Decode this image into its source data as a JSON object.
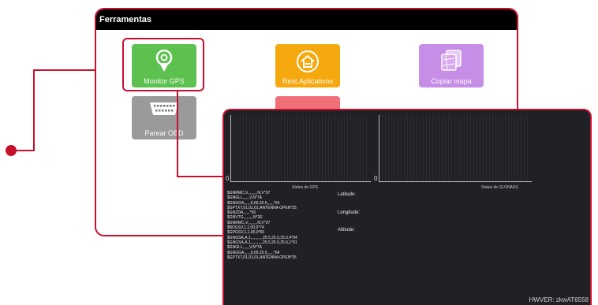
{
  "back": {
    "title": "Ferramentas",
    "tiles": [
      {
        "label": "Monitor GPS",
        "icon": "location-pin-icon",
        "color": "#5cc14f"
      },
      {
        "label": "Rest.Aplicativos",
        "icon": "home-restore-icon",
        "color": "#f6a80f"
      },
      {
        "label": "Copiar mapa",
        "icon": "map-copy-icon",
        "color": "#c68ee6"
      },
      {
        "label": "Parear OBD",
        "icon": "obd-connector-icon",
        "color": "#9a9a9a"
      },
      {
        "label": "",
        "icon": "partial-app-icon",
        "color": "#f0707a"
      }
    ]
  },
  "front": {
    "gps_status": "Status de GPS",
    "glonass_status": "Status de GLONASS",
    "axis_zero": "0",
    "latitude_label": "Latitude:",
    "longitude_label": "Longitude:",
    "altitude_label": "Altitude:",
    "nmea": [
      "$GNRMC,V,,,,,,,,,N,V*37",
      "$GNGLL,,,,,,V,N*7A",
      "$GNGGA,,,,,,0,00,25.5,,,,,,*64",
      "$GPTXT,01,01,01,ANTENNA OPEN*25",
      "$GNZDA,,,,,,*56",
      "$GNVTG,,,,,,,,,N*2E",
      "$GNRMC,V,,,,,,,,,N,V*37",
      "$BDGSV,1,1,00,0*74",
      "$GPGSV,1,1,00,0*65",
      "$GNGSA,A,1,,,,,,,,,,,25.5,25.5,25.5,4*04",
      "$GNGSA,A,1,,,,,,,,,,,25.5,25.5,25.5,1*01",
      "$GNGLL,,,,,,V,N*7A",
      "$GNGGA,,,,,,0,00,25.5,,,,,,*64",
      "$GPTXT,01,01,01,ANTENNA OPEN*25"
    ],
    "hwver": "HWVER: zkwAT6558"
  },
  "colors": {
    "accent": "#c8102e"
  }
}
